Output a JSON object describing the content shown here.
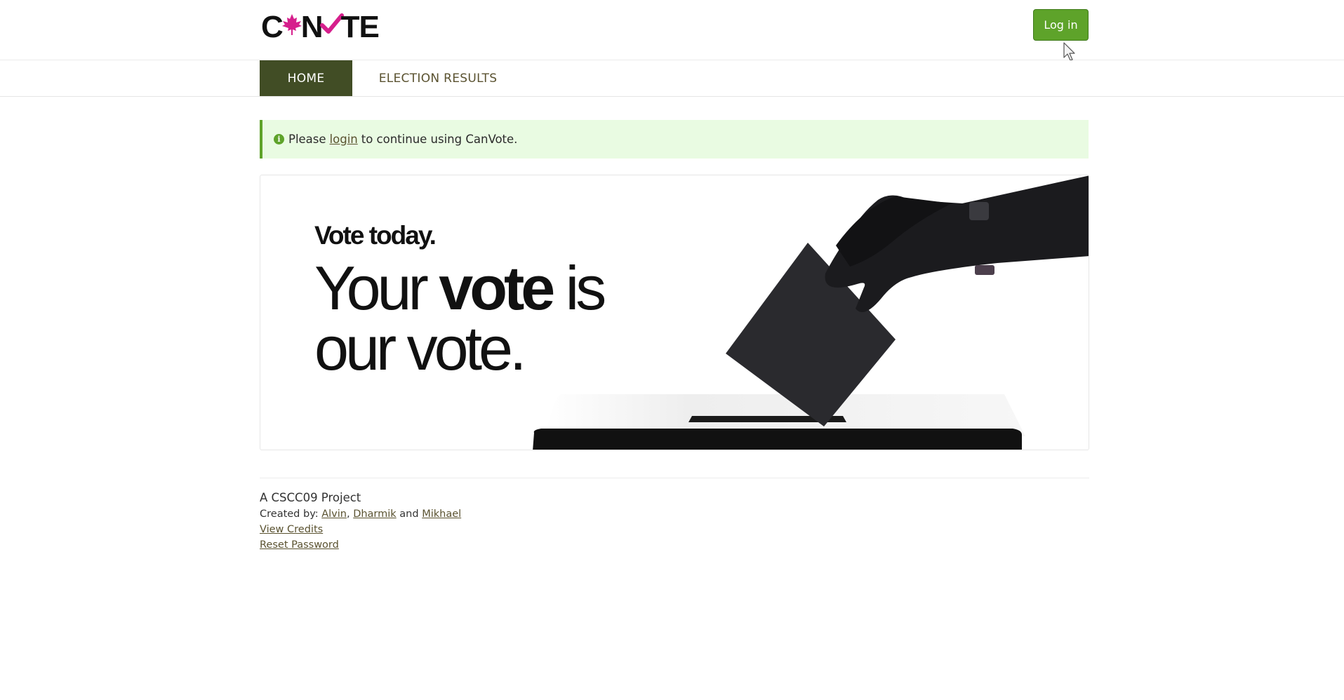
{
  "header": {
    "logo_text_prefix": "C",
    "logo_text_mid": "N",
    "logo_text_suffix": "TE",
    "logo_alt": "CANVOTE",
    "login_button": "Log in"
  },
  "nav": {
    "items": [
      {
        "label": "HOME"
      },
      {
        "label": "ELECTION RESULTS"
      }
    ]
  },
  "alert": {
    "prefix": "Please",
    "link": "login",
    "suffix": "to continue using CanVote."
  },
  "hero": {
    "tagline": "Vote today.",
    "headline_1": "Your",
    "headline_2": "vote",
    "headline_3": "is",
    "headline_4": "our vote."
  },
  "footer": {
    "project": "A CSCC09 Project",
    "created_by": "Created by:",
    "authors": [
      "Alvin",
      "Dharmik",
      "Mikhael"
    ],
    "sep": ",",
    "and": "and",
    "view_credits": "View Credits",
    "reset_password": "Reset Password"
  },
  "colors": {
    "accent_green": "#5ea32a",
    "nav_active": "#414d25",
    "alert_bg": "#e9fbe2",
    "logo_pink": "#d61f8c"
  },
  "icons": {
    "alert": "info-icon",
    "logo_leaf": "maple-leaf-icon",
    "logo_check": "checkmark-icon",
    "cursor": "mouse-cursor-icon"
  }
}
